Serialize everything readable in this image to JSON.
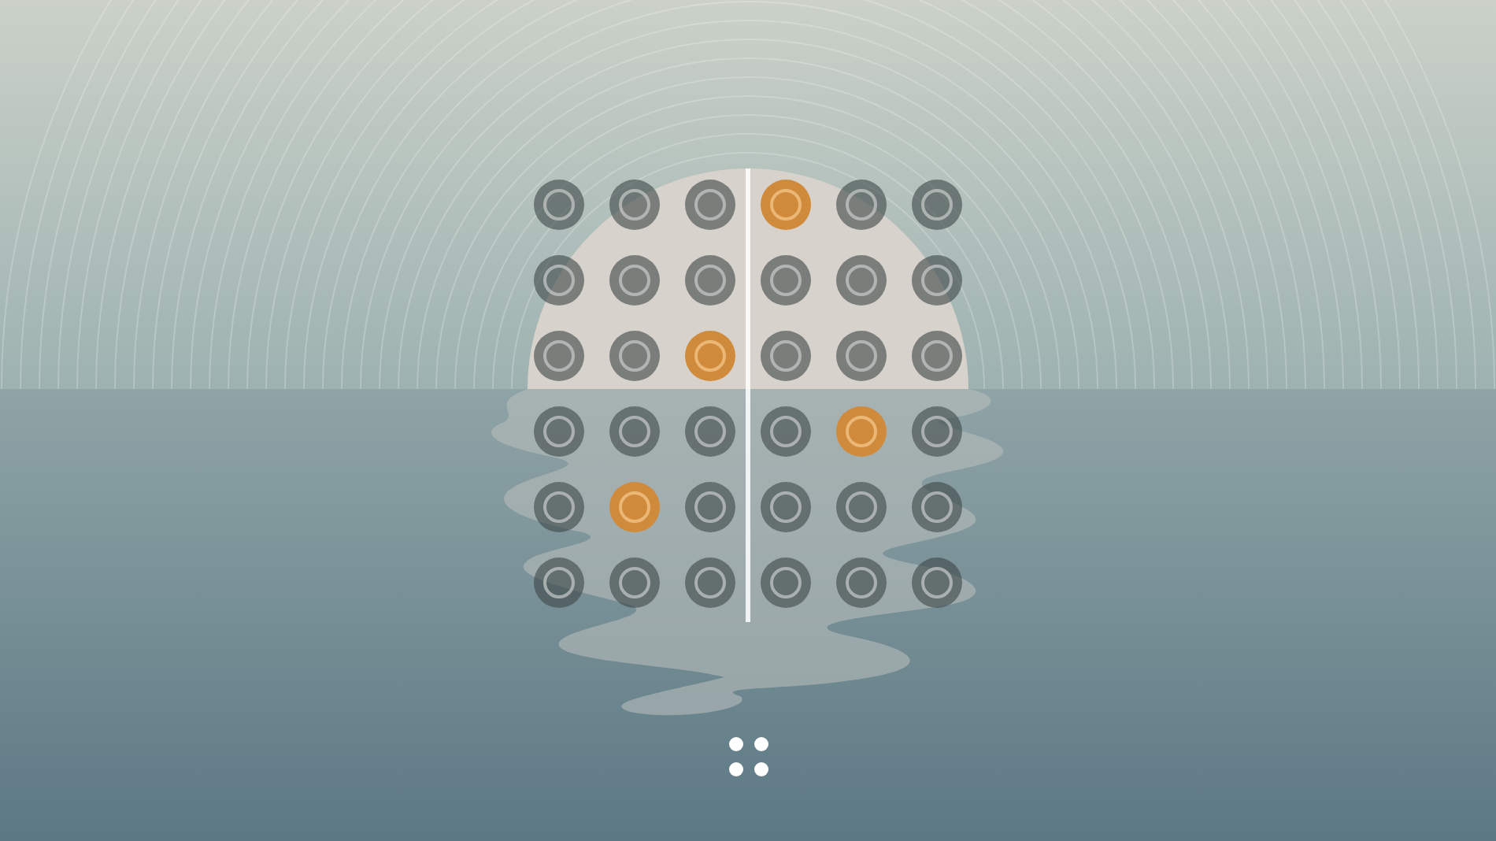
{
  "grid": [
    {
      "cells": [
        {
          "selected": false
        },
        {
          "selected": false
        },
        {
          "selected": false
        },
        {
          "selected": true
        },
        {
          "selected": false
        },
        {
          "selected": false
        }
      ]
    },
    {
      "cells": [
        {
          "selected": false
        },
        {
          "selected": false
        },
        {
          "selected": false
        },
        {
          "selected": false
        },
        {
          "selected": false
        },
        {
          "selected": false
        }
      ]
    },
    {
      "cells": [
        {
          "selected": false
        },
        {
          "selected": false
        },
        {
          "selected": true
        },
        {
          "selected": false
        },
        {
          "selected": false
        },
        {
          "selected": false
        }
      ]
    },
    {
      "cells": [
        {
          "selected": false
        },
        {
          "selected": false
        },
        {
          "selected": false
        },
        {
          "selected": false
        },
        {
          "selected": true
        },
        {
          "selected": false
        }
      ]
    },
    {
      "cells": [
        {
          "selected": false
        },
        {
          "selected": true
        },
        {
          "selected": false
        },
        {
          "selected": false
        },
        {
          "selected": false
        },
        {
          "selected": false
        }
      ]
    },
    {
      "cells": [
        {
          "selected": false
        },
        {
          "selected": false
        },
        {
          "selected": false
        },
        {
          "selected": false
        },
        {
          "selected": false
        },
        {
          "selected": false
        }
      ]
    }
  ]
}
